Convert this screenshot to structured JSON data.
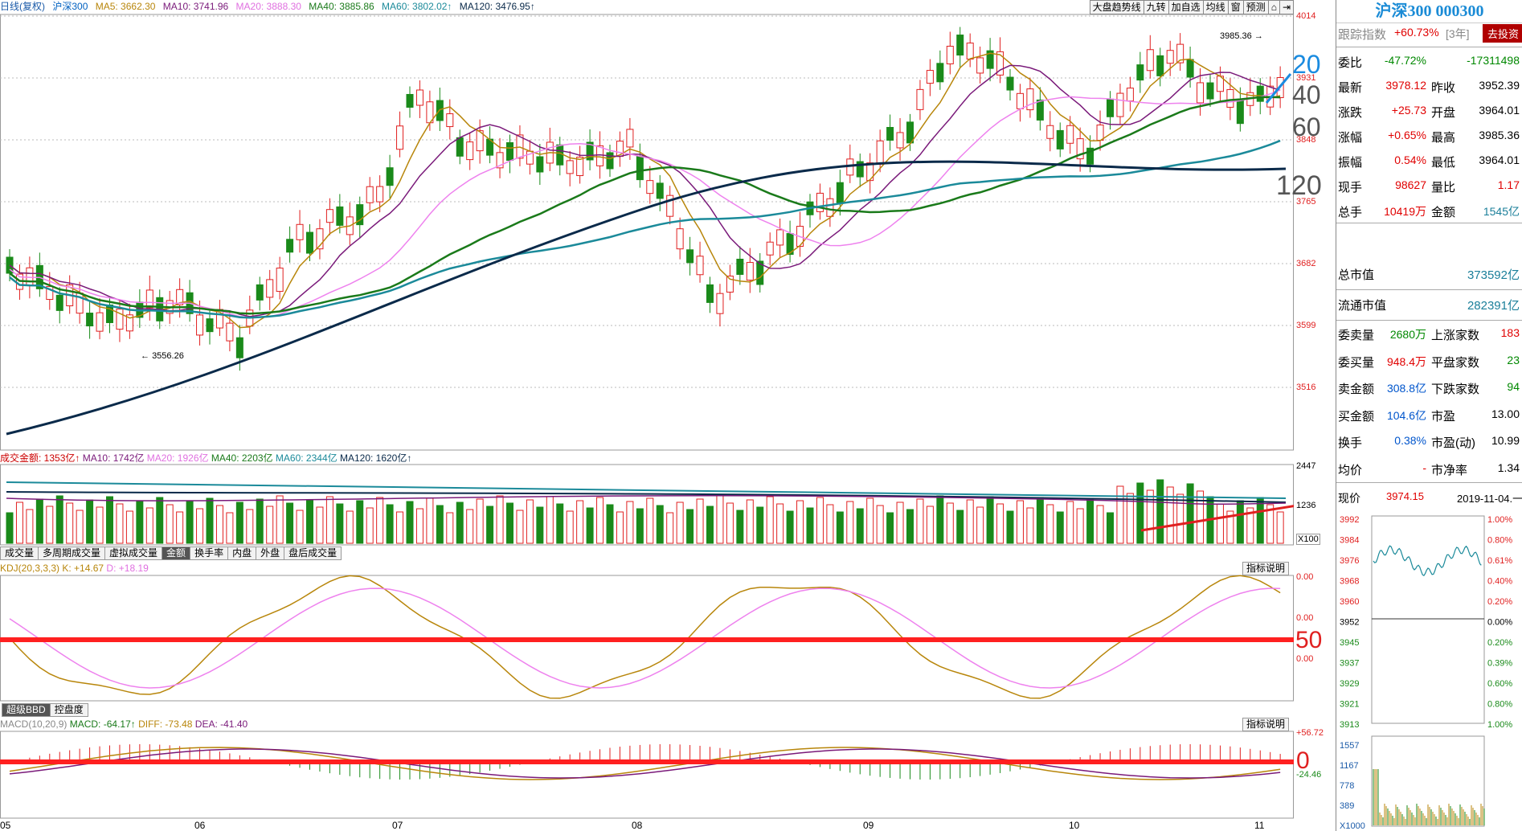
{
  "chart_header": {
    "period": "日线(复权)",
    "name": "沪深300",
    "ma5": "MA5: 3662.30",
    "ma10": "MA10: 3741.96",
    "ma20": "MA20: 3888.30",
    "ma40": "MA40: 3885.86",
    "ma60": "MA60: 3802.02↑",
    "ma120": "MA120: 3476.95↑"
  },
  "toolbar": [
    "大盘趋势线",
    "九转",
    "加自选",
    "均线",
    "窗",
    "预测"
  ],
  "price_axis": [
    "4014",
    "3931",
    "3848",
    "3765",
    "3682",
    "3599",
    "3516"
  ],
  "annotations": {
    "high": "3985.36",
    "low": "3556.26",
    "ma_labels": [
      "20",
      "40",
      "60",
      "120"
    ],
    "kdj_level": "50",
    "macd_level": "0"
  },
  "volume": {
    "title": "成交金额: 1353亿↑",
    "ma10": "MA10: 1742亿",
    "ma20": "MA20: 1926亿",
    "ma40": "MA40: 2203亿",
    "ma60": "MA60: 2344亿",
    "ma120": "MA120: 1620亿↑",
    "axis": [
      "2447",
      "1236",
      "X100"
    ]
  },
  "volume_tabs": [
    "成交量",
    "多周期成交量",
    "虚拟成交量",
    "金额",
    "换手率",
    "内盘",
    "外盘",
    "盘后成交量"
  ],
  "kdj": {
    "title": "KDJ(20,3,3,3) K: +14.67",
    "d": "D: +18.19",
    "button": "指标说明",
    "axis": [
      "0.00",
      "0.00",
      "0.00"
    ]
  },
  "indicator_tabs": [
    "超级BBD",
    "控盘度"
  ],
  "macd": {
    "title": "MACD(10,20,9)",
    "macd": "MACD: -64.17↑",
    "diff": "DIFF: -73.48",
    "dea": "DEA: -41.40",
    "button": "指标说明",
    "axis": [
      "+56.72",
      "-24.46"
    ]
  },
  "x_axis": [
    "05",
    "06",
    "07",
    "08",
    "09",
    "10",
    "11"
  ],
  "panel": {
    "title": "沪深300 000300",
    "track_label": "跟踪指数",
    "track_value": "+60.73%",
    "track_period": "[3年]",
    "invest_button": "去投资",
    "rows": [
      {
        "l1": "委比",
        "v1": "-47.72%",
        "l2": "",
        "v2": "-17311498"
      },
      {
        "l1": "最新",
        "v1": "3978.12",
        "l2": "昨收",
        "v2": "3952.39"
      },
      {
        "l1": "涨跌",
        "v1": "+25.73",
        "l2": "开盘",
        "v2": "3964.01"
      },
      {
        "l1": "涨幅",
        "v1": "+0.65%",
        "l2": "最高",
        "v2": "3985.36"
      },
      {
        "l1": "振幅",
        "v1": "0.54%",
        "l2": "最低",
        "v2": "3964.01"
      },
      {
        "l1": "现手",
        "v1": "98627",
        "l2": "量比",
        "v2": "1.17"
      },
      {
        "l1": "总手",
        "v1": "10419万",
        "l2": "金额",
        "v2": "1545亿"
      }
    ],
    "market_cap_label": "总市值",
    "market_cap": "373592亿",
    "float_cap_label": "流通市值",
    "float_cap": "282391亿",
    "stats": [
      {
        "l1": "委卖量",
        "v1": "2680万",
        "l2": "上涨家数",
        "v2": "183"
      },
      {
        "l1": "委买量",
        "v1": "948.4万",
        "l2": "平盘家数",
        "v2": "23"
      },
      {
        "l1": "卖金额",
        "v1": "308.8亿",
        "l2": "下跌家数",
        "v2": "94"
      },
      {
        "l1": "买金额",
        "v1": "104.6亿",
        "l2": "市盈",
        "v2": "13.00"
      },
      {
        "l1": "换手",
        "v1": "0.38%",
        "l2": "市盈(动)",
        "v2": "10.99"
      },
      {
        "l1": "均价",
        "v1": "-",
        "l2": "市净率",
        "v2": "1.34"
      }
    ],
    "now_label": "现价",
    "now_value": "3974.15",
    "now_date": "2019-11-04.一",
    "mini_left_axis": [
      "3992",
      "3984",
      "3976",
      "3968",
      "3960",
      "3952",
      "3945",
      "3937",
      "3929",
      "3921",
      "3913"
    ],
    "mini_right_axis": [
      "1.00%",
      "0.80%",
      "0.61%",
      "0.40%",
      "0.20%",
      "0.00%",
      "0.20%",
      "0.39%",
      "0.60%",
      "0.80%",
      "1.00%"
    ],
    "mini_vol_axis": [
      "1557",
      "1167",
      "778",
      "389",
      "X1000"
    ]
  },
  "colors": {
    "up": "#e02020",
    "down": "#1a8a1a",
    "ma5": "#b8860b",
    "ma10": "#7a1a7a",
    "ma20": "#ee82ee",
    "ma40": "#1a7a1a",
    "ma60": "#1b8a9a",
    "ma120": "#0a2a4a"
  }
}
